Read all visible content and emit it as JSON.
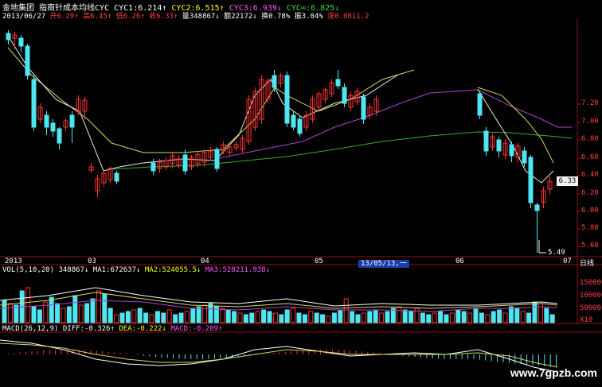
{
  "header": {
    "stock_name": "金地集团",
    "indicator_title": "指南针成本均线CYC",
    "cyc1": {
      "label": "CYC1:",
      "value": "6.214",
      "arrow": "↑"
    },
    "cyc2": {
      "label": "CYC2:",
      "value": "6.515",
      "arrow": "↑"
    },
    "cyc3": {
      "label": "CYC3:",
      "value": "6.939",
      "arrow": "↓"
    },
    "cycinf": {
      "label": "CYC∞:",
      "value": "6.825",
      "arrow": "↓"
    },
    "date": "2013/06/27",
    "open": {
      "label": "开",
      "value": "6.29",
      "arrow": "↑"
    },
    "high": {
      "label": "高",
      "value": "6.45",
      "arrow": "↑"
    },
    "low": {
      "label": "低",
      "value": "6.26",
      "arrow": "↑"
    },
    "close": {
      "label": "收",
      "value": "6.33",
      "arrow": "↑"
    },
    "volume": {
      "label": "量",
      "value": "348867",
      "arrow": "↓"
    },
    "amount": {
      "label": "额",
      "value": "22172",
      "arrow": "↓"
    },
    "turnover": {
      "label": "换",
      "value": "0.78%"
    },
    "amplitude": {
      "label": "振",
      "value": "3.04%"
    },
    "change": {
      "label": "涨",
      "value": "0.0811.2"
    }
  },
  "price_axis": [
    "7.20",
    "7.00",
    "6.80",
    "6.60",
    "6.40",
    "6.20",
    "6.00",
    "5.80",
    "5.60"
  ],
  "current_price_tag": "6.33",
  "low_annotation": "5.49",
  "x_axis": {
    "labels": [
      "2013",
      "03",
      "04",
      "05",
      "06",
      "07"
    ],
    "highlight": "13/05/13,一",
    "period": "日线"
  },
  "volume_panel": {
    "title": "VOL(5,10,20)",
    "value": "348867",
    "value_arrow": "↓",
    "ma1": {
      "label": "MA1:",
      "value": "672637",
      "arrow": "↓"
    },
    "ma2": {
      "label": "MA2:",
      "value": "524055.5",
      "arrow": "↓"
    },
    "ma3": {
      "label": "MA3:",
      "value": "528211.938",
      "arrow": "↓"
    },
    "axis": [
      "150000",
      "100000",
      "50000"
    ],
    "unit": "X10"
  },
  "macd_panel": {
    "title": "MACD(26,12,9)",
    "diff": {
      "label": "DIFF:",
      "value": "-0.326",
      "arrow": "↑"
    },
    "dea": {
      "label": "DEA:",
      "value": "-0.222",
      "arrow": "↓"
    },
    "macd": {
      "label": "MACD:",
      "value": "-0.209",
      "arrow": "↑"
    }
  },
  "watermark": "www.7gpzb.com",
  "colors": {
    "up": "#ff3030",
    "down": "#4ee6f0",
    "background": "#000000",
    "ma_purple": "#b040d0",
    "ma_green": "#30b030"
  }
}
